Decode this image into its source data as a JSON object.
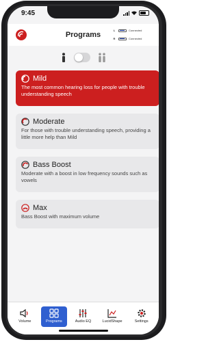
{
  "status": {
    "time": "9:45"
  },
  "header": {
    "title": "Programs",
    "left_device": {
      "side": "L",
      "status": "Connected",
      "battery": 0.8
    },
    "right_device": {
      "side": "R",
      "status": "Connected",
      "battery": 0.8
    }
  },
  "mode_toggle": {
    "left_icon": "single-person-icon",
    "right_icon": "two-people-icon",
    "on": false
  },
  "programs": [
    {
      "name": "Mild",
      "description": "The most common hearing loss for people with trouble understanding speech",
      "selected": true
    },
    {
      "name": "Moderate",
      "description": "For those with trouble understanding speech, providing a little more help than Mild",
      "selected": false
    },
    {
      "name": "Bass Boost",
      "description": "Moderate with a boost in low frequency sounds such as vowels",
      "selected": false
    },
    {
      "name": "Max",
      "description": "Bass Boost with maximum volume",
      "selected": false
    }
  ],
  "tabs": [
    {
      "label": "Volume",
      "icon": "speaker-icon"
    },
    {
      "label": "Programs",
      "icon": "grid-icon",
      "selected": true
    },
    {
      "label": "Audio EQ",
      "icon": "sliders-icon"
    },
    {
      "label": "LucidShape",
      "icon": "chart-icon"
    },
    {
      "label": "Settings",
      "icon": "gear-icon"
    }
  ],
  "colors": {
    "accent_red": "#cc1f1f",
    "accent_blue": "#2f5fd0",
    "card_bg": "#e8e8ea"
  }
}
